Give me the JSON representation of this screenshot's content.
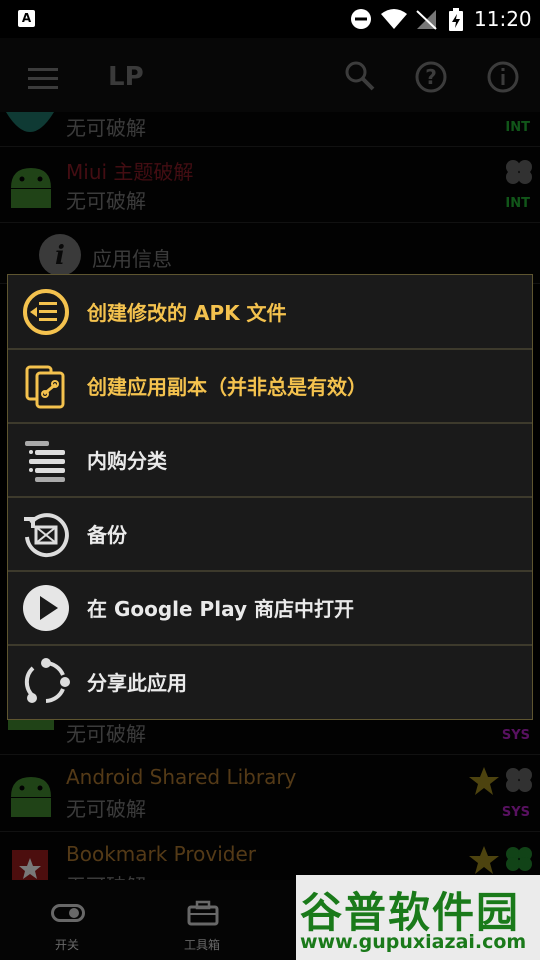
{
  "status_bar": {
    "time": "11:20",
    "notification_icon": "A"
  },
  "toolbar": {
    "title": "LP"
  },
  "list_items": [
    {
      "sub": "无可破解",
      "tag": "INT"
    },
    {
      "name": "Miui 主题破解",
      "sub": "无可破解",
      "tag": "INT"
    },
    {
      "info_label": "应用信息"
    },
    {
      "sub": "无可破解",
      "tag": "SYS"
    },
    {
      "name": "Android Shared Library",
      "sub": "无可破解",
      "tag": "SYS"
    },
    {
      "name": "Bookmark Provider",
      "sub": "无可破解"
    }
  ],
  "context_menu": {
    "items": [
      {
        "label": "创建修改的 APK 文件",
        "icon": "apk-list-icon"
      },
      {
        "label": "创建应用副本（并非总是有效）",
        "icon": "copy-link-icon"
      },
      {
        "label": "内购分类",
        "icon": "inapp-list-icon"
      },
      {
        "label": "备份",
        "icon": "backup-icon"
      },
      {
        "label": "在 Google Play 商店中打开",
        "icon": "play-icon"
      },
      {
        "label": "分享此应用",
        "icon": "share-icon"
      }
    ]
  },
  "bottom_nav": {
    "items": [
      {
        "label": "开关",
        "icon": "toggle-icon"
      },
      {
        "label": "工具箱",
        "icon": "toolbox-icon"
      }
    ]
  },
  "watermark": {
    "name": "谷普软件园",
    "url": "www.gupuxiazai.com"
  },
  "colors": {
    "gold": "#f4c24e",
    "int_tag": "#1f9d2f",
    "sys_tag": "#a020b0",
    "red_name": "#7a1822",
    "orange_name": "#9a6a2a"
  }
}
